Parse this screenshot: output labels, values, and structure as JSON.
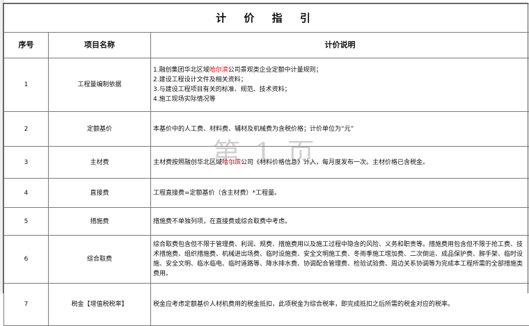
{
  "title": "计 价 指 引",
  "headers": {
    "index": "序号",
    "name": "项目名称",
    "description": "计价说明"
  },
  "rows": [
    {
      "index": "1",
      "name": "工程量编制依据",
      "description_parts": [
        "1.融创集团华北区域",
        "哈尔滨",
        "公司景观类企业定额中计量规则；\n2.建设工程设计文件及相关资料；\n3.与建设工程项目有关的标准、规范、技术资料；\n4.施工现场实际情况等"
      ]
    },
    {
      "index": "2",
      "name": "定额基价",
      "description": "本基价中的人工费、材料费、辅材及机械费为含税价格；计价单位为“元”"
    },
    {
      "index": "3",
      "name": "主材费",
      "description_parts": [
        "主材费按照融创华北区域",
        "哈尔滨",
        "公司《材料价格信息》计入，每月度发布一次。主材价格已含税金。"
      ]
    },
    {
      "index": "4",
      "name": "直接费",
      "description": "工程直接费=定额基价（含主材费）*工程量。"
    },
    {
      "index": "5",
      "name": "措施费",
      "description": "措施费不单独列项，在直接费或综合取费中考虑。"
    },
    {
      "index": "6",
      "name": "综合取费",
      "description": "综合取费包含但不限于管理费、利润、规费、措施费用以及施工过程中隐含的风险、义务和职责等。措施费用包含但不限于抢工费、技术措施费、组织措施费、机械进出场费、临时设施费、安全文明施工费、冬雨季施工增加费、二次倒运、成品保护费、脚手架、临时设施、安全文明、临水临电、临时道路等、降水排水费、协调配合管理费、检验试验费、周边关系协调等为完成本工程所需的全部措施类费用。"
    },
    {
      "index": "7",
      "name": "税金【增值税税率】",
      "description": "税金应考虑定额基价人材机费用的税金抵扣，此项税金为综合税率，即完成抵扣之后所需的税金对应的税率。"
    }
  ],
  "watermark": "第 1 页",
  "colors": {
    "highlight_red": "#e00000",
    "watermark": "#787878"
  }
}
